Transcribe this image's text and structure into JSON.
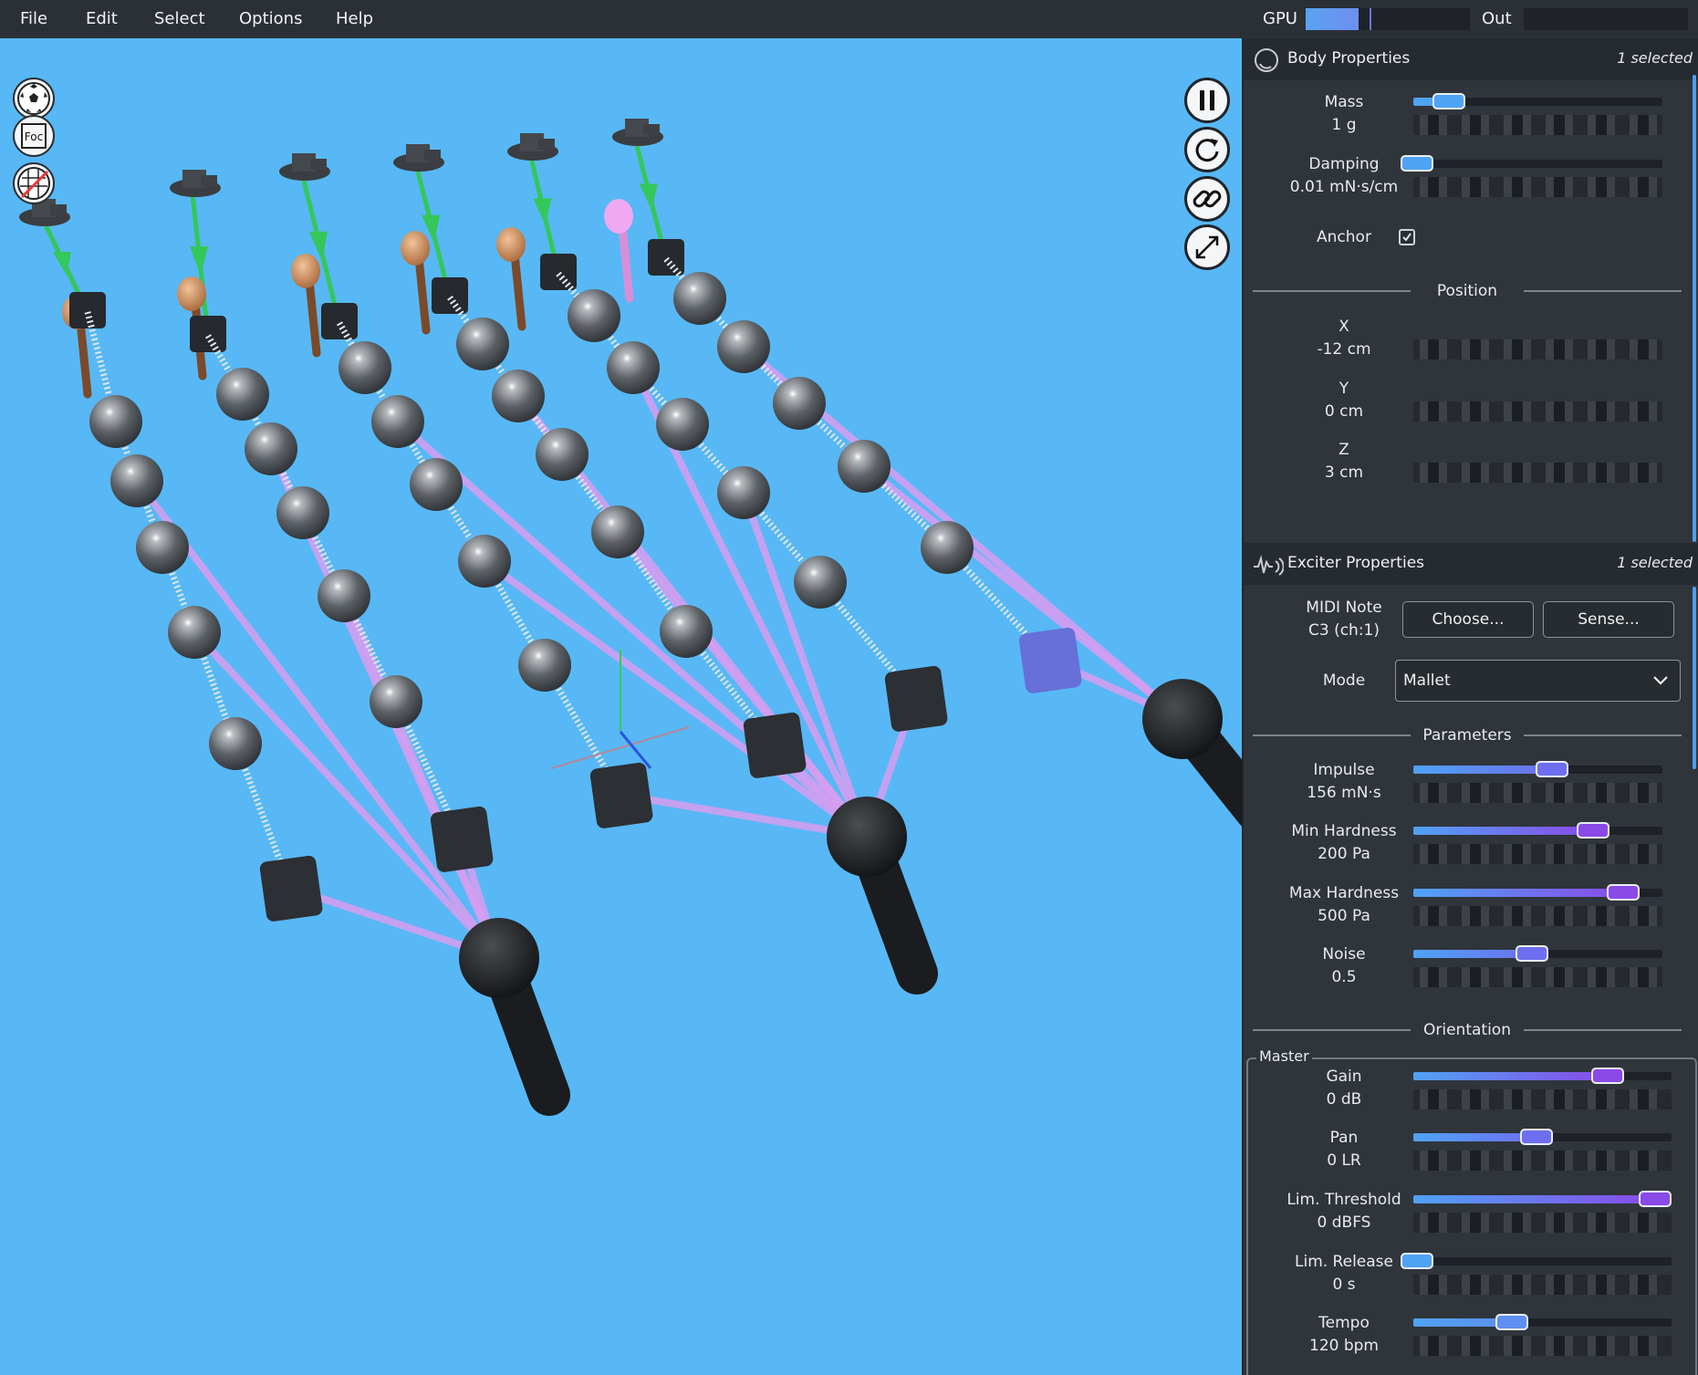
{
  "menu": [
    "File",
    "Edit",
    "Select",
    "Options",
    "Help"
  ],
  "meters": {
    "gpu_label": "GPU",
    "gpu_level": 0.32,
    "out_label": "Out",
    "out_level": 0.0
  },
  "viewport": {
    "left_tools": [
      {
        "name": "soccer-ball-icon",
        "label": ""
      },
      {
        "name": "focus-icon",
        "label": "Foc"
      },
      {
        "name": "grid-disabled-icon",
        "label": ""
      }
    ],
    "right_tools": [
      {
        "name": "pause-icon"
      },
      {
        "name": "reset-icon"
      },
      {
        "name": "link-icon"
      },
      {
        "name": "fullscreen-icon"
      }
    ],
    "colors": {
      "background": "#57b8f5",
      "string_line": "#d79cf0",
      "anchor_line": "#34c759",
      "ball": "#5c6166",
      "block": "#2c2f33",
      "hammer": "#d49a6a",
      "selected_hammer": "#f0a8f0",
      "selected_block": "#6670d8"
    }
  },
  "body_properties": {
    "title": "Body Properties",
    "selected": "1 selected",
    "mass_label": "Mass",
    "mass_value": "1 g",
    "mass_level": 0.14,
    "damping_label": "Damping",
    "damping_value": "0.01 mN·s/cm",
    "damping_level": 0.0,
    "anchor_label": "Anchor",
    "anchor_checked": true,
    "position_heading": "Position",
    "x_label": "X",
    "x_value": "-12 cm",
    "y_label": "Y",
    "y_value": "0 cm",
    "z_label": "Z",
    "z_value": "3 cm"
  },
  "exciter_properties": {
    "title": "Exciter Properties",
    "selected": "1 selected",
    "midi_label": "MIDI Note",
    "midi_value": "C3 (ch:1)",
    "choose_button": "Choose...",
    "sense_button": "Sense...",
    "mode_label": "Mode",
    "mode_value": "Mallet",
    "parameters_heading": "Parameters",
    "impulse_label": "Impulse",
    "impulse_value": "156 mN·s",
    "impulse_level": 0.59,
    "min_hardness_label": "Min Hardness",
    "min_hardness_value": "200 Pa",
    "min_hardness_level": 0.77,
    "max_hardness_label": "Max Hardness",
    "max_hardness_value": "500 Pa",
    "max_hardness_level": 0.9,
    "noise_label": "Noise",
    "noise_value": "0.5",
    "noise_level": 0.5,
    "orientation_heading": "Orientation"
  },
  "master": {
    "legend": "Master",
    "gain_label": "Gain",
    "gain_value": "0 dB",
    "gain_level": 0.8,
    "pan_label": "Pan",
    "pan_value": "0 LR",
    "pan_level": 0.5,
    "lim_threshold_label": "Lim. Threshold",
    "lim_threshold_value": "0 dBFS",
    "lim_threshold_level": 1.0,
    "lim_release_label": "Lim. Release",
    "lim_release_value": "0 s",
    "lim_release_level": 0.0,
    "tempo_label": "Tempo",
    "tempo_value": "120 bpm",
    "tempo_level": 0.4
  }
}
